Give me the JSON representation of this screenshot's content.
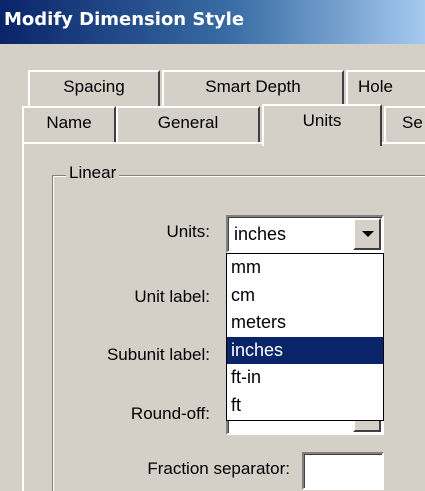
{
  "window": {
    "title": "Modify Dimension Style"
  },
  "tabs": {
    "row1": [
      "Spacing",
      "Smart Depth",
      "Hole"
    ],
    "row2": [
      "Name",
      "General",
      "Units",
      "Se"
    ],
    "active": "Units"
  },
  "linear": {
    "group_label": "Linear",
    "units_label": "Units:",
    "units_value": "inches",
    "unit_label_label": "Unit label:",
    "subunit_label_label": "Subunit label:",
    "roundoff_label": "Round-off:",
    "fraction_separator_label": "Fraction separator:",
    "fraction_separator_value": ""
  },
  "units_dropdown": {
    "options": [
      "mm",
      "cm",
      "meters",
      "inches",
      "ft-in",
      "ft"
    ],
    "selected": "inches"
  },
  "colors": {
    "title_start": "#0a246a",
    "title_end": "#a6caf0",
    "selection": "#0a246a",
    "face": "#d4d0c8"
  }
}
